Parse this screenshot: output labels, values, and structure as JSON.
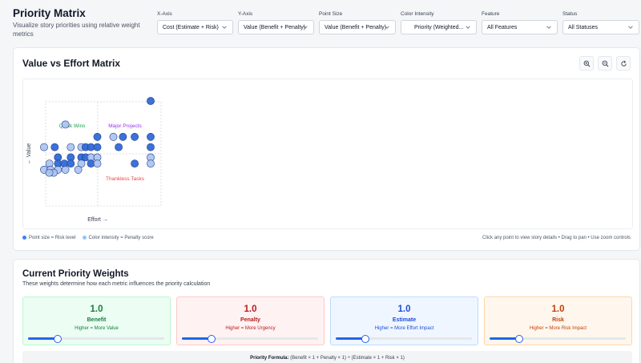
{
  "header": {
    "title": "Priority Matrix",
    "subtitle": "Visualize story priorities using relative weight metrics"
  },
  "filters": [
    {
      "label": "X-Axis",
      "value": "Cost (Estimate + Risk)"
    },
    {
      "label": "Y-Axis",
      "value": "Value (Benefit + Penalty)"
    },
    {
      "label": "Point Size",
      "value": "Value (Benefit + Penalty)"
    },
    {
      "label": "Color Intensity",
      "value": "Priority (Weighted..."
    },
    {
      "label": "Feature",
      "value": "All Features"
    },
    {
      "label": "Status",
      "value": "All Statuses"
    }
  ],
  "matrix": {
    "title": "Value vs Effort Matrix",
    "buttons": {
      "zoom_in": "zoom-in-icon",
      "zoom_out": "zoom-out-icon",
      "reset": "reset-icon"
    },
    "legend": {
      "size_note": "Point size = Risk level",
      "color_note": "Color intensity = Penalty score"
    },
    "hint": "Click any point to view story details • Drag to pan • Use zoom controls"
  },
  "chart_data": {
    "type": "scatter",
    "xlabel": "Effort →",
    "ylabel": "← Value",
    "quadrants": {
      "top_left": "Quick Wins",
      "top_right": "Major Projects",
      "bottom_right": "Thankless Tasks"
    },
    "colors": {
      "dark": "#2f6ad8",
      "light": "#a9c2ef",
      "stroke": "#1e3a8a",
      "quick_wins": "#16a34a",
      "major_projects": "#9333ea",
      "thankless": "#ef4444"
    },
    "points": [
      {
        "x": 10,
        "y": 10,
        "s": 1
      },
      {
        "x": 2,
        "y": 7.7,
        "s": 0
      },
      {
        "x": 5,
        "y": 6.5,
        "s": 1
      },
      {
        "x": 6.5,
        "y": 6.5,
        "s": 0
      },
      {
        "x": 7.4,
        "y": 6.5,
        "s": 1
      },
      {
        "x": 8.5,
        "y": 6.5,
        "s": 1
      },
      {
        "x": 10,
        "y": 6.5,
        "s": 1
      },
      {
        "x": 0,
        "y": 5.5,
        "s": 0
      },
      {
        "x": 1,
        "y": 5.5,
        "s": 1
      },
      {
        "x": 2.5,
        "y": 5.5,
        "s": 0
      },
      {
        "x": 3.5,
        "y": 5.5,
        "s": 0
      },
      {
        "x": 3.9,
        "y": 5.5,
        "s": 1
      },
      {
        "x": 4.4,
        "y": 5.5,
        "s": 1
      },
      {
        "x": 5,
        "y": 5.5,
        "s": 1
      },
      {
        "x": 7,
        "y": 5.5,
        "s": 1
      },
      {
        "x": 10,
        "y": 5.5,
        "s": 1
      },
      {
        "x": 1.3,
        "y": 4.5,
        "s": 1
      },
      {
        "x": 2.5,
        "y": 4.5,
        "s": 1
      },
      {
        "x": 3.5,
        "y": 4.5,
        "s": 1
      },
      {
        "x": 3.9,
        "y": 4.5,
        "s": 1
      },
      {
        "x": 4.4,
        "y": 4.5,
        "s": 0
      },
      {
        "x": 5,
        "y": 4.5,
        "s": 0
      },
      {
        "x": 10,
        "y": 4.5,
        "s": 0
      },
      {
        "x": 0.5,
        "y": 3.9,
        "s": 0
      },
      {
        "x": 1.3,
        "y": 3.9,
        "s": 1
      },
      {
        "x": 1.9,
        "y": 3.9,
        "s": 1
      },
      {
        "x": 2.5,
        "y": 3.9,
        "s": 1
      },
      {
        "x": 3.5,
        "y": 3.9,
        "s": 0
      },
      {
        "x": 4.4,
        "y": 3.9,
        "s": 1
      },
      {
        "x": 5,
        "y": 3.9,
        "s": 0
      },
      {
        "x": 8.5,
        "y": 3.9,
        "s": 1
      },
      {
        "x": 10,
        "y": 3.9,
        "s": 0
      },
      {
        "x": 0,
        "y": 3.3,
        "s": 0
      },
      {
        "x": 0.6,
        "y": 3.3,
        "s": 0
      },
      {
        "x": 1.3,
        "y": 3.3,
        "s": 0
      },
      {
        "x": 2.0,
        "y": 3.3,
        "s": 0
      },
      {
        "x": 3.2,
        "y": 3.3,
        "s": 0
      },
      {
        "x": 0.9,
        "y": 3.0,
        "s": 0
      },
      {
        "x": 0.5,
        "y": 3.0,
        "s": 0
      }
    ]
  },
  "weights": {
    "title": "Current Priority Weights",
    "subtitle": "These weights determine how each metric influences the priority calculation",
    "items": [
      {
        "value": "1.0",
        "name": "Benefit",
        "desc": "Higher = More Value",
        "level": 0.22,
        "accent": "#15803d",
        "bg": "#ecfdf3",
        "border": "#bbf7d0"
      },
      {
        "value": "1.0",
        "name": "Penalty",
        "desc": "Higher = More Urgency",
        "level": 0.22,
        "accent": "#b91c1c",
        "bg": "#fef2f2",
        "border": "#fecaca"
      },
      {
        "value": "1.0",
        "name": "Estimate",
        "desc": "Higher = More Effort Impact",
        "level": 0.22,
        "accent": "#1d4ed8",
        "bg": "#eff6ff",
        "border": "#bfdbfe"
      },
      {
        "value": "1.0",
        "name": "Risk",
        "desc": "Higher = More Risk Impact",
        "level": 0.22,
        "accent": "#c2410c",
        "bg": "#fff7ed",
        "border": "#fed7aa"
      }
    ],
    "formula_label": "Priority Formula:",
    "formula": "(Benefit × 1 + Penalty × 1) ÷ (Estimate × 1 + Risk × 1)"
  }
}
